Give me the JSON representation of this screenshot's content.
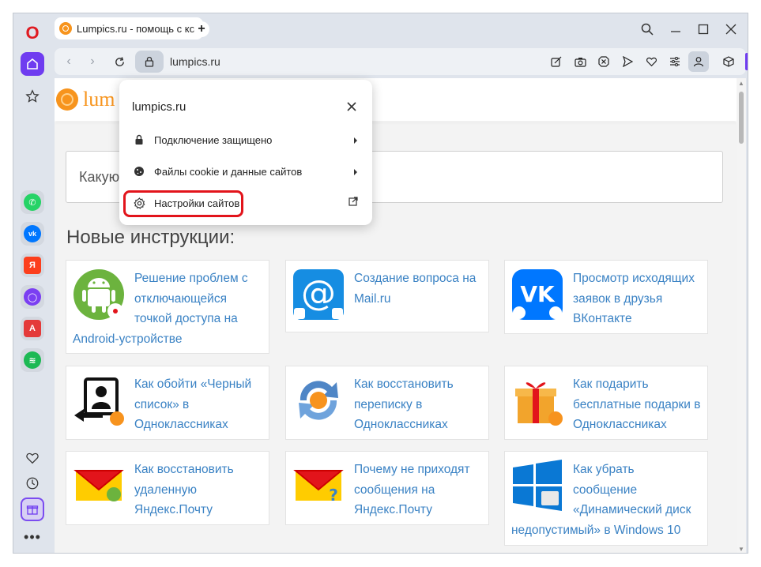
{
  "browser": {
    "tab": {
      "title": "Lumpics.ru - помощь с ко",
      "favicon": "orange-icon"
    },
    "new_tab_icon": "plus-icon",
    "address": {
      "url": "lumpics.ru"
    }
  },
  "sidebar": {
    "logo": "O",
    "apps": [
      {
        "name": "whatsapp",
        "color": "#25d366",
        "glyph": "✆"
      },
      {
        "name": "vk",
        "color": "#0077ff",
        "glyph": "vk"
      },
      {
        "name": "yandex",
        "color": "#fc3f1d",
        "glyph": "Я"
      },
      {
        "name": "alice",
        "color": "#7b3ff2",
        "glyph": "◯"
      },
      {
        "name": "translator",
        "color": "#e43a3a",
        "glyph": "A"
      },
      {
        "name": "spotify",
        "color": "#1db954",
        "glyph": "≋"
      }
    ]
  },
  "site": {
    "logo_text": "lum",
    "search_placeholder": "Какую",
    "section_title": "Новые инструкции:",
    "cards": [
      {
        "title": "Решение проблем с отключающейся точкой доступа на Android-устройстве",
        "thumb": "android-icon"
      },
      {
        "title": "Создание вопроса на Mail.ru",
        "thumb": "mail-at-icon"
      },
      {
        "title": "Просмотр исходящих заявок в друзья ВКонтакте",
        "thumb": "vk-logo-icon"
      },
      {
        "title": "Как обойти «Черный список» в Одноклассниках",
        "thumb": "blacklist-icon"
      },
      {
        "title": "Как восстановить переписку в Одноклассниках",
        "thumb": "restore-arrows-icon"
      },
      {
        "title": "Как подарить бесплатные подарки в Одноклассниках",
        "thumb": "gift-box-icon"
      },
      {
        "title": "Как восстановить удаленную Яндекс.Почту",
        "thumb": "yandex-mail-icon"
      },
      {
        "title": "Почему не приходят сообщения на Яндекс.Почту",
        "thumb": "yandex-mail-icon"
      },
      {
        "title": "Как убрать сообщение «Динамический диск недопустимый» в Windows 10",
        "thumb": "windows-logo-icon"
      }
    ]
  },
  "popup": {
    "title": "lumpics.ru",
    "items": [
      {
        "label": "Подключение защищено",
        "icon": "lock-icon"
      },
      {
        "label": "Файлы cookie и данные сайтов",
        "icon": "cookie-icon"
      },
      {
        "label": "Настройки сайтов",
        "icon": "gear-icon"
      }
    ],
    "highlight_color": "#e2141b"
  }
}
